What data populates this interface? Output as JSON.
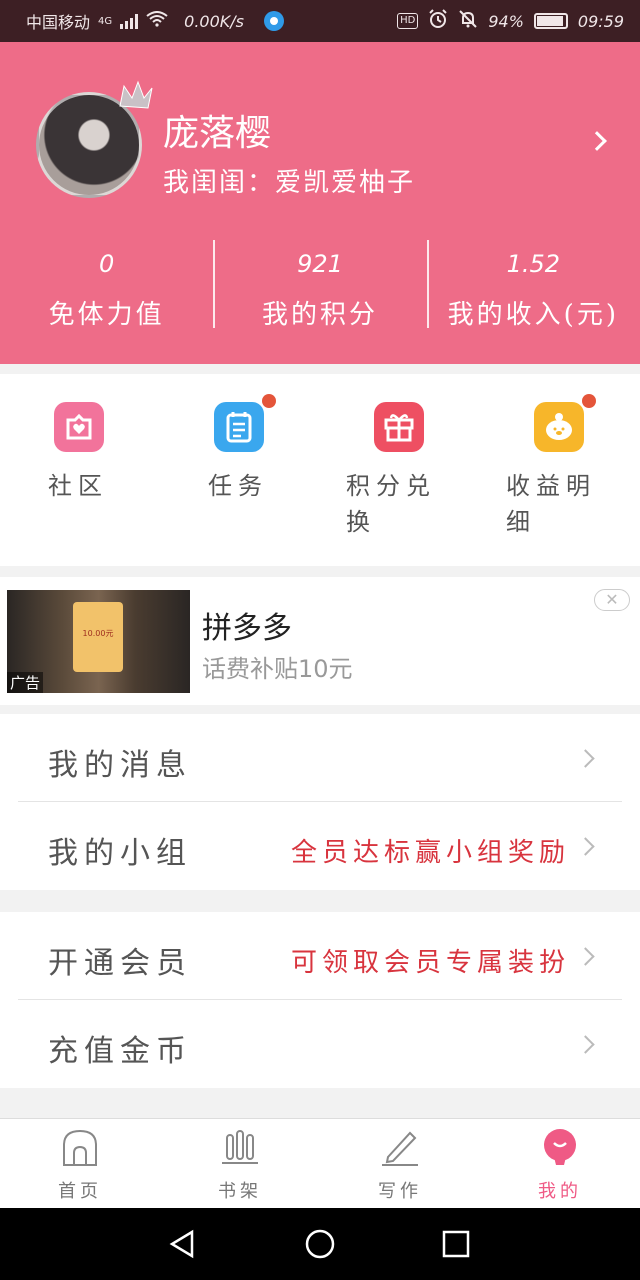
{
  "status_bar": {
    "carrier": "中国移动",
    "network": "4G",
    "speed": "0.00K/s",
    "hd": "HD",
    "battery": "94%",
    "time": "09:59"
  },
  "profile": {
    "username": "庞落樱",
    "subtitle": "我闺闺：爱凯爱柚子"
  },
  "stats": [
    {
      "value": "0",
      "label": "免体力值"
    },
    {
      "value": "921",
      "label": "我的积分"
    },
    {
      "value": "1.52",
      "label": "我的收入(元)"
    }
  ],
  "features": [
    {
      "label": "社区",
      "icon": "community-icon",
      "color": "#f2739b",
      "badge": false
    },
    {
      "label": "任务",
      "icon": "task-icon",
      "color": "#3aa7ee",
      "badge": true
    },
    {
      "label": "积分兑换",
      "icon": "gift-icon",
      "color": "#ee4f62",
      "badge": false
    },
    {
      "label": "收益明细",
      "icon": "piggy-icon",
      "color": "#f7b62a",
      "badge": true
    }
  ],
  "ad": {
    "title": "拼多多",
    "subtitle": "话费补贴10元",
    "tag": "广告",
    "card_text": "10.00元",
    "close": "✕"
  },
  "menu_group_1": [
    {
      "title": "我的消息",
      "extra": ""
    },
    {
      "title": "我的小组",
      "extra": "全员达标赢小组奖励"
    }
  ],
  "menu_group_2": [
    {
      "title": "开通会员",
      "extra": "可领取会员专属装扮"
    },
    {
      "title": "充值金币",
      "extra": ""
    }
  ],
  "tabs": [
    {
      "label": "首页",
      "icon": "home-icon"
    },
    {
      "label": "书架",
      "icon": "bookshelf-icon"
    },
    {
      "label": "写作",
      "icon": "write-icon"
    },
    {
      "label": "我的",
      "icon": "profile-icon",
      "active": true
    }
  ],
  "colors": {
    "header_bg": "#ee6c88",
    "accent_red": "#d8343e",
    "active_tab": "#ef5a85"
  }
}
